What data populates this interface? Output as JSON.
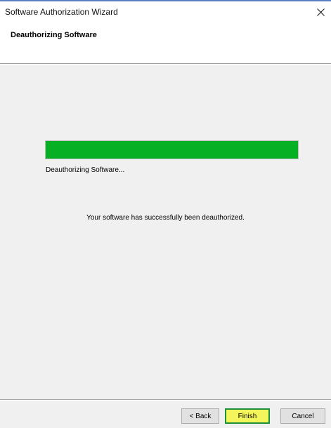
{
  "window": {
    "title": "Software Authorization Wizard",
    "close_icon": "close-icon"
  },
  "header": {
    "title": "Deauthorizing Software"
  },
  "progress": {
    "fraction": 1.0,
    "color": "#06b025",
    "status_text": "Deauthorizing Software..."
  },
  "main": {
    "message": "Your software has successfully been deauthorized."
  },
  "buttons": {
    "back_label": "< Back",
    "finish_label": "Finish",
    "cancel_label": "Cancel"
  },
  "colors": {
    "finish_highlight": "#f3f55a",
    "finish_border": "#1f8f3a"
  }
}
